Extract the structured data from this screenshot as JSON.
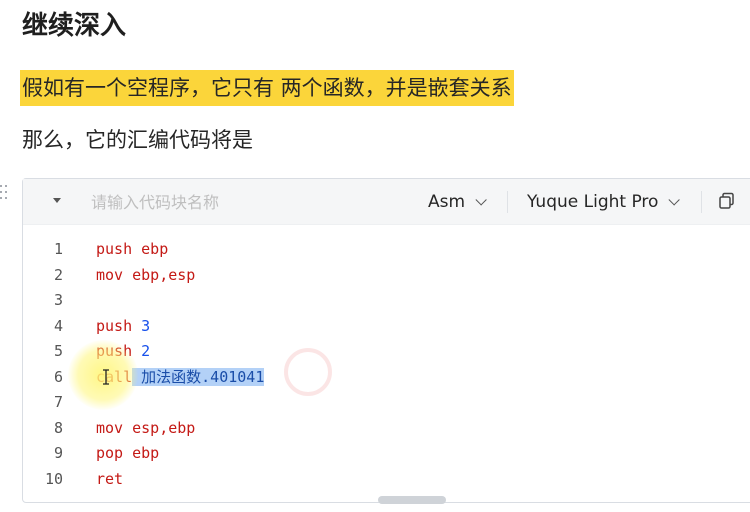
{
  "heading": "继续深入",
  "highlight_text": "假如有一个空程序，它只有 两个函数，并是嵌套关系",
  "paragraph": "那么，它的汇编代码将是",
  "code_block": {
    "title_placeholder": "请输入代码块名称",
    "language": "Asm",
    "theme": "Yuque Light Pro",
    "line_numbers": [
      "1",
      "2",
      "3",
      "4",
      "5",
      "6",
      "7",
      "8",
      "9",
      "10"
    ],
    "lines": {
      "l1": "push ebp",
      "l2": "mov ebp,esp",
      "l3": "",
      "l4_kw": "push ",
      "l4_num": "3",
      "l5_kw": "push ",
      "l5_num": "2",
      "l6_kw": "call",
      "l6_sel": " 加法函数.401041",
      "l7": "",
      "l8": "mov esp,ebp",
      "l9": "pop ebp",
      "l10": "ret"
    }
  },
  "colors": {
    "highlight": "#fbd53a",
    "keyword": "#c41a16",
    "number": "#1750eb",
    "selection": "#b3d1f7"
  },
  "icons": [
    "drag-handle-icon",
    "collapse-arrow-icon",
    "chevron-down-icon",
    "copy-icon",
    "text-cursor-icon"
  ]
}
